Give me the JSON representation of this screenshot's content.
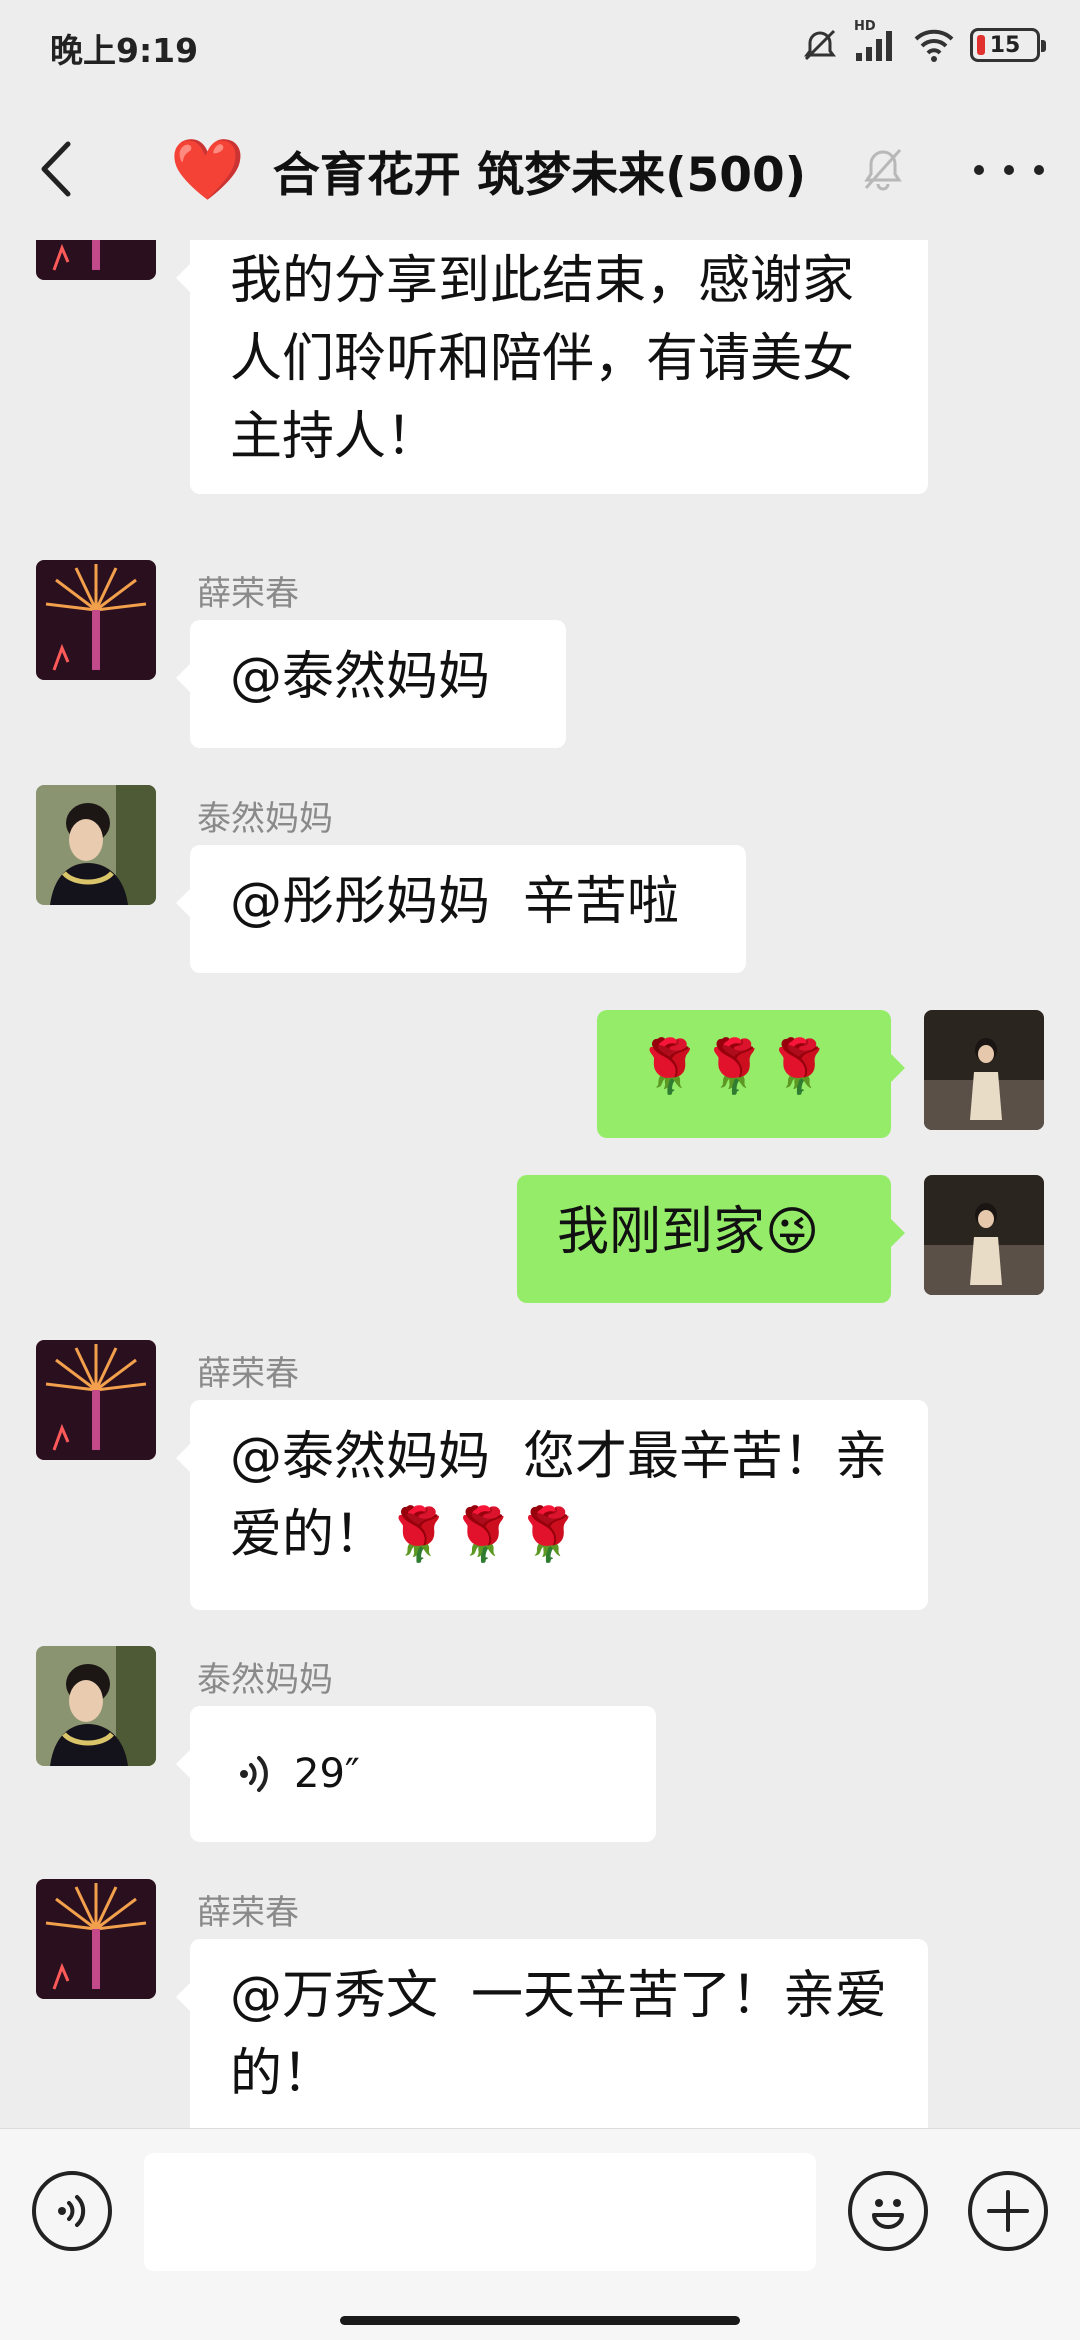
{
  "status_bar": {
    "time": "晚上9:19",
    "network_label": "HD",
    "battery": "15",
    "battery_level_percent": 15,
    "battery_color": "#e0312f"
  },
  "header": {
    "title": "合育花开 筑梦未来(500)",
    "heart": "❤️"
  },
  "messages": [
    {
      "side": "left",
      "sender": "",
      "avatar": "fireworks-avatar",
      "text": "我的分享到此结束，感谢家人们聆听和陪伴，有请美女主持人！"
    },
    {
      "side": "left",
      "sender": "薛荣春",
      "avatar": "fireworks-avatar",
      "text": "@泰然妈妈"
    },
    {
      "side": "left",
      "sender": "泰然妈妈",
      "avatar": "woman-portrait-avatar",
      "text": "@彤彤妈妈  辛苦啦"
    },
    {
      "side": "right",
      "avatar": "self-portrait-avatar",
      "text": "🌹🌹🌹"
    },
    {
      "side": "right",
      "avatar": "self-portrait-avatar",
      "text": "我刚到家😜"
    },
    {
      "side": "left",
      "sender": "薛荣春",
      "avatar": "fireworks-avatar",
      "text": "@泰然妈妈  您才最辛苦！亲爱的！🌹🌹🌹"
    },
    {
      "side": "left",
      "sender": "泰然妈妈",
      "avatar": "woman-portrait-avatar",
      "voice_duration": "29″"
    },
    {
      "side": "left",
      "sender": "薛荣春",
      "avatar": "fireworks-avatar",
      "text": "@万秀文  一天辛苦了！亲爱的！"
    }
  ],
  "input_bar": {
    "voice_icon": "voice-mode-icon",
    "emoji_icon": "emoji-icon",
    "plus_icon": "plus-icon",
    "value": ""
  },
  "colors": {
    "background": "#ededed",
    "bubble_incoming": "#ffffff",
    "bubble_outgoing": "#95ec69",
    "sender_name": "#8a8a8a"
  }
}
